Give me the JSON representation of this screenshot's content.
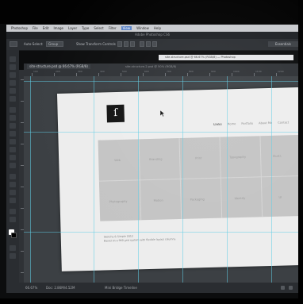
{
  "app": {
    "title": "Adobe Photoshop CS6"
  },
  "menubar": {
    "items": [
      "Photoshop",
      "File",
      "Edit",
      "Image",
      "Layer",
      "Type",
      "Select",
      "Filter",
      "View",
      "Window",
      "Help"
    ],
    "active_index": 8
  },
  "options_bar": {
    "auto_select_label": "Auto-Select:",
    "auto_select_value": "Group",
    "transform_label": "Show Transform Controls",
    "workspace_label": "Essentials"
  },
  "browser_url": "site-structure.psd @ 66.67% (RGB/8) — Photoshop",
  "document": {
    "tab_label": "site-structure.psd @ 66.67% (RGB/8)",
    "tab_secondary": "site-structure-2.psd @ 50% (RGB/8)"
  },
  "ruler_labels": [
    "100",
    "200",
    "300",
    "400",
    "500",
    "600",
    "700",
    "800",
    "900",
    "1000",
    "1100",
    "1200"
  ],
  "page": {
    "nav": [
      "Links",
      "Home",
      "Portfolio",
      "About Me",
      "Contact"
    ],
    "nav_active_index": 0,
    "grid_cells": [
      [
        "Web",
        "Branding",
        "Print",
        "Typography",
        "Illustr."
      ],
      [
        "Photography",
        "Motion",
        "Packaging",
        "Identity",
        "UI"
      ]
    ],
    "footer_lines": [
      "Sketchy & Simple 2012",
      "Based on a 960 grid system with flexible layout columns."
    ]
  },
  "status": {
    "zoom": "66.67%",
    "doc_info": "Doc: 2.86M/4.52M",
    "panel_tab": "Mini Bridge   Timeline"
  }
}
